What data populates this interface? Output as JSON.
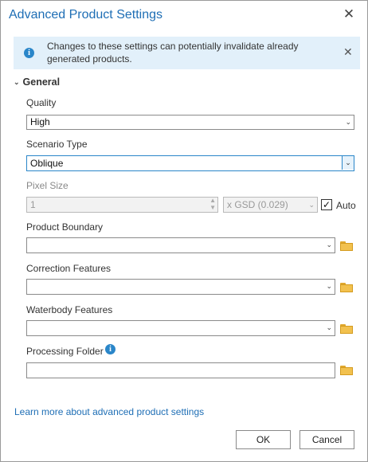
{
  "dialog": {
    "title": "Advanced Product Settings",
    "close_glyph": "✕"
  },
  "banner": {
    "icon_glyph": "i",
    "message": "Changes to these settings can potentially invalidate already generated products.",
    "close_glyph": "✕"
  },
  "section": {
    "chevron": "⌄",
    "title": "General"
  },
  "fields": {
    "quality": {
      "label": "Quality",
      "value": "High"
    },
    "scenario_type": {
      "label": "Scenario Type",
      "value": "Oblique"
    },
    "pixel_size": {
      "label": "Pixel Size",
      "value": "1",
      "unit": "x GSD (0.029)",
      "auto_label": "Auto",
      "auto_checked": true,
      "check_glyph": "✓"
    },
    "product_boundary": {
      "label": "Product Boundary",
      "value": ""
    },
    "correction_features": {
      "label": "Correction Features",
      "value": ""
    },
    "waterbody_features": {
      "label": "Waterbody Features",
      "value": ""
    },
    "processing_folder": {
      "label": "Processing Folder",
      "value": "",
      "info_glyph": "i"
    }
  },
  "footer": {
    "link": "Learn more about advanced product settings",
    "ok_label": "OK",
    "cancel_label": "Cancel"
  },
  "icons": {
    "dropdown_arrow": "⌄",
    "spinner_up": "▲",
    "spinner_down": "▼"
  },
  "colors": {
    "title": "#1e6eb5",
    "banner_bg": "#e2f0fa",
    "info_icon": "#2a86c9",
    "folder": "#f2c14e",
    "link": "#1e6eb5"
  }
}
